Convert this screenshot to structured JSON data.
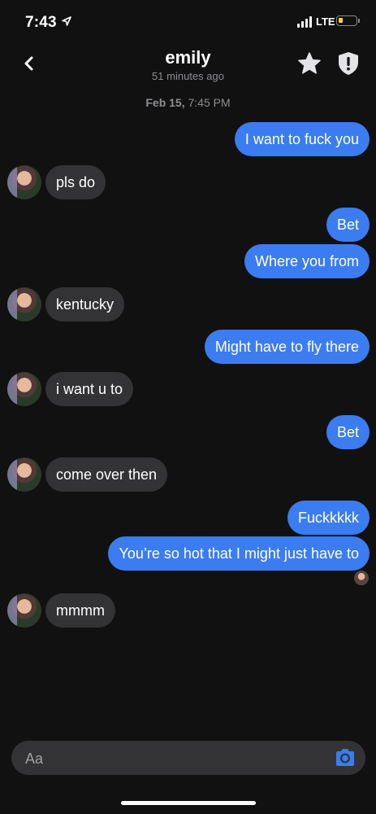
{
  "status": {
    "time": "7:43",
    "network": "LTE",
    "icons": [
      "location-arrow-icon",
      "signal-icon",
      "battery-icon"
    ]
  },
  "header": {
    "contact_name": "emily",
    "last_seen": "51 minutes ago",
    "icons": [
      "back-chevron-icon",
      "star-icon",
      "shield-icon"
    ]
  },
  "thread": {
    "timestamp_date": "Feb 15,",
    "timestamp_time": "7:45 PM",
    "messages": [
      {
        "from": "me",
        "text": "I want to fuck you"
      },
      {
        "from": "emily",
        "text": "pls do"
      },
      {
        "from": "me",
        "text": "Bet"
      },
      {
        "from": "me",
        "text": "Where you from"
      },
      {
        "from": "emily",
        "text": "kentucky"
      },
      {
        "from": "me",
        "text": "Might have to fly there"
      },
      {
        "from": "emily",
        "text": "i want u to"
      },
      {
        "from": "me",
        "text": "Bet"
      },
      {
        "from": "emily",
        "text": "come over then"
      },
      {
        "from": "me",
        "text": "Fuckkkkk"
      },
      {
        "from": "me",
        "text": "You’re so hot that I might just have to"
      },
      {
        "from": "emily",
        "text": "mmmm"
      }
    ]
  },
  "composer": {
    "placeholder": "Aa",
    "camera_icon": "camera-icon"
  },
  "colors": {
    "background": "#111111",
    "sent_bubble": "#3b7cf0",
    "received_bubble": "#333335",
    "accent": "#3b7cf0"
  }
}
